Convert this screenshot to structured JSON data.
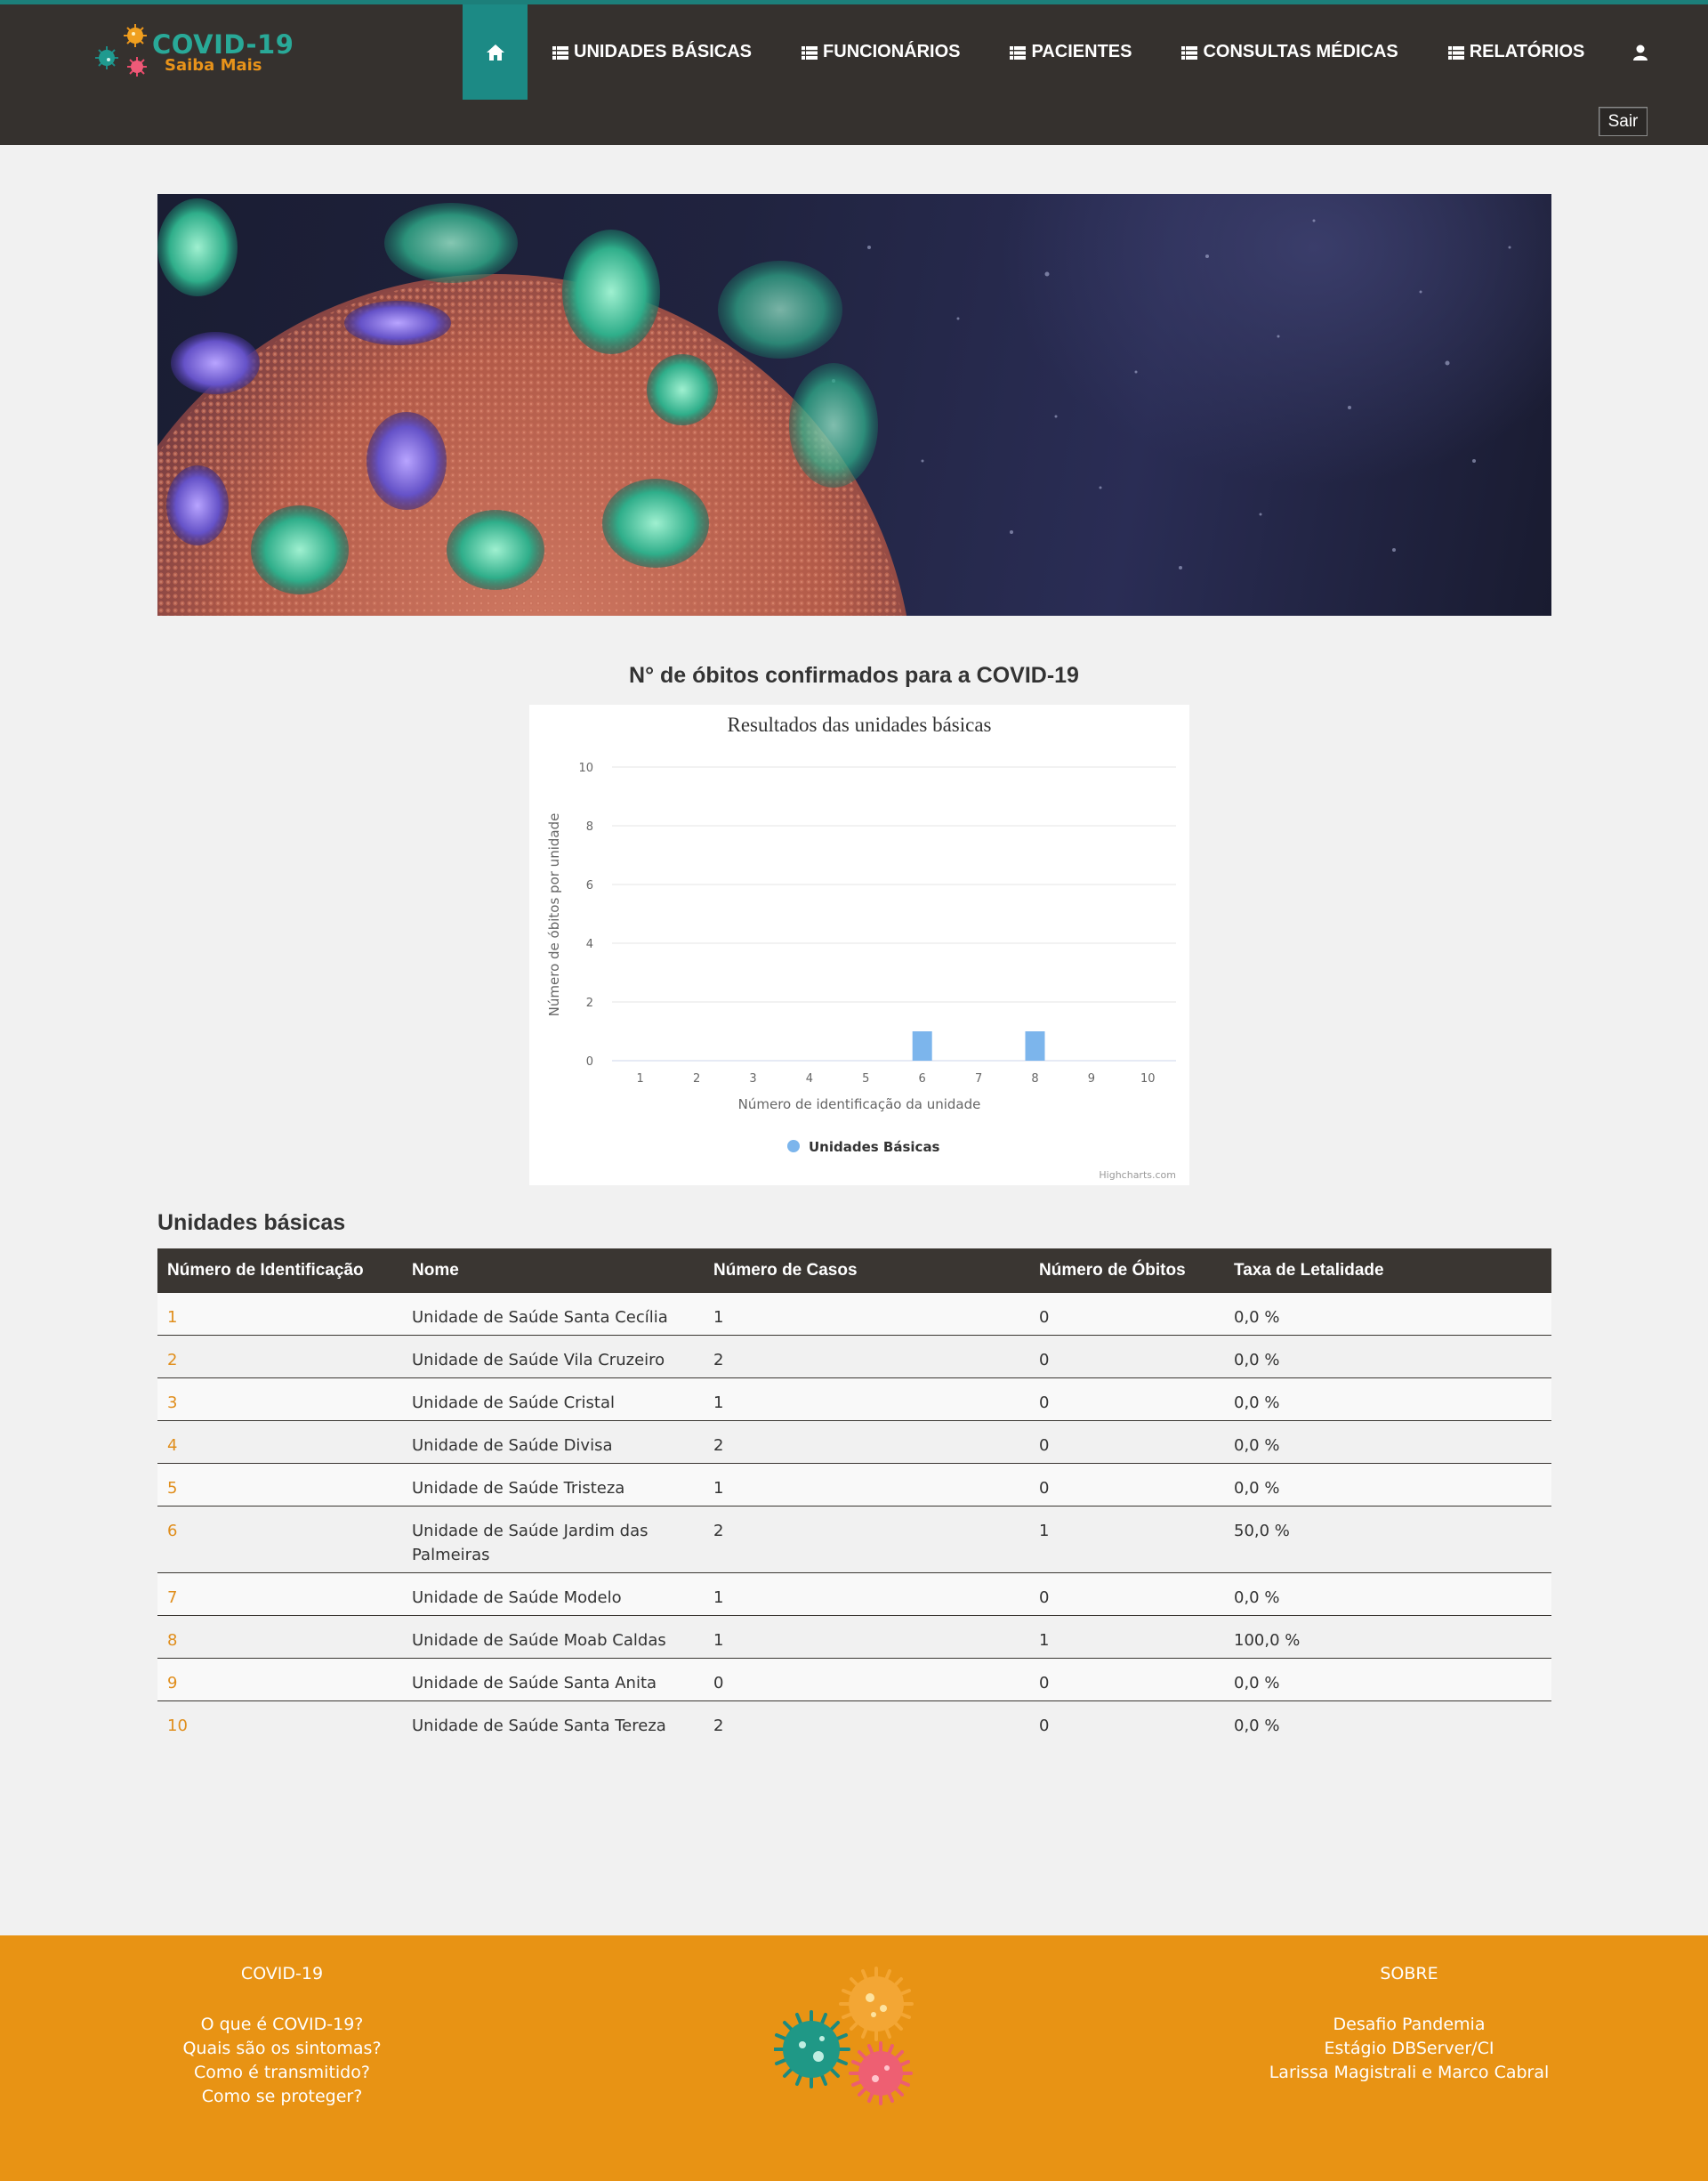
{
  "brand": {
    "title": "COVID-19",
    "subtitle": "Saiba Mais"
  },
  "nav": {
    "items": [
      {
        "label": "UNIDADES BÁSICAS",
        "icon": "list-icon"
      },
      {
        "label": "FUNCIONÁRIOS",
        "icon": "list-icon"
      },
      {
        "label": "PACIENTES",
        "icon": "list-icon"
      },
      {
        "label": "CONSULTAS MÉDICAS",
        "icon": "list-icon"
      },
      {
        "label": "RELATÓRIOS",
        "icon": "list-icon"
      }
    ],
    "home_icon": "home-icon",
    "user_icon": "user-icon",
    "logout_label": "Sair"
  },
  "chart_section": {
    "heading": "N° de óbitos confirmados para a COVID-19"
  },
  "chart_data": {
    "type": "bar",
    "title": "Resultados das unidades básicas",
    "xlabel": "Número de identificação da unidade",
    "ylabel": "Número de óbitos por unidade",
    "categories": [
      "1",
      "2",
      "3",
      "4",
      "5",
      "6",
      "7",
      "8",
      "9",
      "10"
    ],
    "series": [
      {
        "name": "Unidades Básicas",
        "values": [
          0,
          0,
          0,
          0,
          0,
          1,
          0,
          1,
          0,
          0
        ]
      }
    ],
    "ylim": [
      0,
      10
    ],
    "yticks": [
      "0",
      "2",
      "4",
      "6",
      "8",
      "10"
    ],
    "grid": true,
    "legend": "bottom-center",
    "credits": "Highcharts.com",
    "color": "#7cb5ec"
  },
  "table": {
    "heading": "Unidades básicas",
    "columns": [
      "Número de Identificação",
      "Nome",
      "Número de Casos",
      "Número de Óbitos",
      "Taxa de Letalidade"
    ],
    "rows": [
      {
        "id": "1",
        "name": "Unidade de Saúde Santa Cecília",
        "cases": "1",
        "deaths": "0",
        "rate": "0,0 %"
      },
      {
        "id": "2",
        "name": "Unidade de Saúde Vila Cruzeiro",
        "cases": "2",
        "deaths": "0",
        "rate": "0,0 %"
      },
      {
        "id": "3",
        "name": "Unidade de Saúde Cristal",
        "cases": "1",
        "deaths": "0",
        "rate": "0,0 %"
      },
      {
        "id": "4",
        "name": "Unidade de Saúde Divisa",
        "cases": "2",
        "deaths": "0",
        "rate": "0,0 %"
      },
      {
        "id": "5",
        "name": "Unidade de Saúde Tristeza",
        "cases": "1",
        "deaths": "0",
        "rate": "0,0 %"
      },
      {
        "id": "6",
        "name": "Unidade de Saúde Jardim das Palmeiras",
        "cases": "2",
        "deaths": "1",
        "rate": "50,0 %"
      },
      {
        "id": "7",
        "name": "Unidade de Saúde Modelo",
        "cases": "1",
        "deaths": "0",
        "rate": "0,0 %"
      },
      {
        "id": "8",
        "name": "Unidade de Saúde Moab Caldas",
        "cases": "1",
        "deaths": "1",
        "rate": "100,0 %"
      },
      {
        "id": "9",
        "name": "Unidade de Saúde Santa Anita",
        "cases": "0",
        "deaths": "0",
        "rate": "0,0 %"
      },
      {
        "id": "10",
        "name": "Unidade de Saúde Santa Tereza",
        "cases": "2",
        "deaths": "0",
        "rate": "0,0 %"
      }
    ]
  },
  "footer": {
    "left": {
      "title": "COVID-19",
      "links": [
        "O que é COVID-19?",
        "Quais são os sintomas?",
        "Como é transmitido?",
        "Como se proteger?"
      ]
    },
    "right": {
      "title": "SOBRE",
      "lines": [
        "Desafio Pandemia",
        "Estágio DBServer/CI",
        "Larissa Magistrali e Marco Cabral"
      ]
    },
    "logo_icon": "virus-icon"
  },
  "colors": {
    "nav_bg": "#35312e",
    "accent_teal": "#1c8a85",
    "footer_orange": "#e89314",
    "link_orange": "#e08e1c",
    "bar": "#7cb5ec"
  }
}
